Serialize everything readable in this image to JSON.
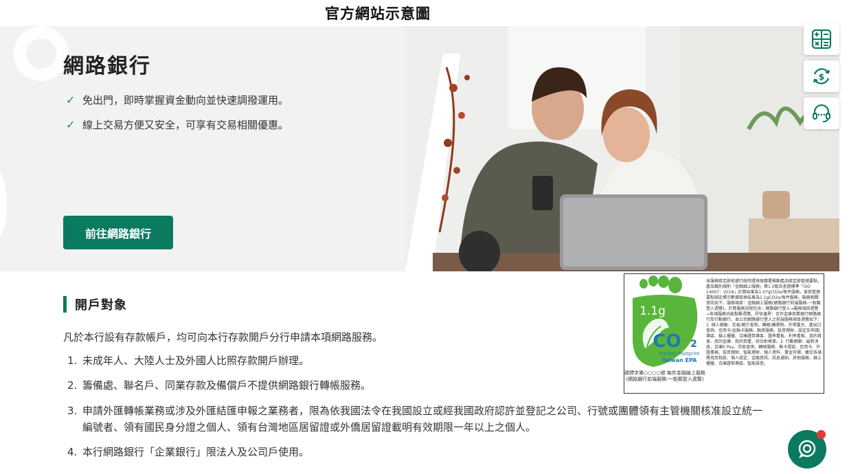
{
  "caption": "官方網站示意圖",
  "hero": {
    "title": "網路銀行",
    "points": [
      "免出門，即時掌握資金動向並快速調撥運用。",
      "線上交易方便又安全，可享有交易相關優惠。"
    ],
    "cta_label": "前往網路銀行",
    "point_icon": "check-icon"
  },
  "float_buttons": [
    "calculator-icon",
    "currency-exchange-icon",
    "customer-service-icon"
  ],
  "section": {
    "title": "開戶對象",
    "intro": "凡於本行設有存款帳戶，均可向本行存款開戶分行申請本項網路服務。",
    "rules": [
      {
        "num": "1.",
        "text": "未成年人、大陸人士及外國人比照存款開戶辦理。"
      },
      {
        "num": "2.",
        "text": "籌備處、聯名戶、同業存款及備償戶不提供網路銀行轉帳服務。"
      },
      {
        "num": "3.",
        "text": "申請外匯轉帳業務或涉及外匯結匯申報之業務者，限為依我國法令在我國設立或經我國政府認許並登記之公司、行號或團體領有主管機關核准設立統一編號者、領有國民身分證之個人、領有台灣地區居留證或外僑居留證載明有效期限一年以上之個人。"
      },
      {
        "num": "4.",
        "text": "本行網路銀行「企業銀行」限法人及公司戶使用。"
      }
    ]
  },
  "carbon_label": {
    "value": "1.1g",
    "co2": "CO",
    "co2_sub": "2",
    "subtitle_1": "Carbon Footprint",
    "subtitle_2": "Taiwan EPA",
    "caption": "碳標字第○○○○號 每件金融線上服務 (網路銀行前端服務-一般類登入週覽)",
    "text": "本服務碳足跡依據行政院環境保護署推動產品碳足跡管理要點，產品類別規則「金融線上服務」第1.0版及查證標準「ISO 14067：2018」計算結果為1.07gCO2e/每件服務，並依管理要點規定標示數據取捨結果為1.1gCO2e/每件服務，服務相關資訊如下。服務項目：金融線上服務(網路銀行前端服務-一般類登入週覽)。計算服務流程包含：網路銀行登入→服務項目週覽→各項服務功能點擊週覽。評估邊界：合作金庫商業銀行網路銀行及行動銀行。本公司網路銀行登入之前端服務項目週覽如下：1. 個人網銀：交易/帳戶查詢、轉帳/繳費稅、外幣匯兌、進出口查詢、信用卡/金融卡服務、融資服務、投資理財、設定及申請/專區、線上櫃檯、合庫證券專區、匯率看板、利率看板、我的首頁、我的金庫、我的資產、綜合對帳單。2. 行動網銀：最新消息、合庫E Pay、存款查詢、轉帳服務、無卡提款、信用卡、外匯業務、投資理財、智能理財、個人資料、黃金存摺、繳交各項費用及稅款、個人設定、金融資訊、訊息通知、其他服務、線上櫃檯、合庫證券專區、智能語音。"
  },
  "chat_icon": "chat-icon",
  "colors": {
    "brand_green": "#0a7a60",
    "foot_green": "#5ab53c",
    "co2_blue": "#1f78b4",
    "alert_red": "#e53935"
  }
}
